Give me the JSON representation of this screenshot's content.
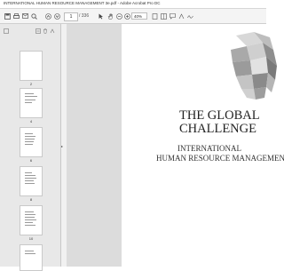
{
  "window": {
    "title": "INTERNATIONAL HUMAN RESOURCE MANAGEMENT 3e.pdf - Adobe Acrobat Pro DC"
  },
  "toolbar": {
    "page_value": "1",
    "page_total": "/ 336",
    "zoom_value": "40%"
  },
  "sidebar": {
    "thumbnails": [
      {
        "label": "2"
      },
      {
        "label": "4"
      },
      {
        "label": "6"
      },
      {
        "label": "8"
      },
      {
        "label": "10"
      },
      {
        "label": ""
      }
    ]
  },
  "page": {
    "title_line1": "THE GLOBAL",
    "title_line2": "CHALLENGE",
    "subtitle_line1": "INTERNATIONAL",
    "subtitle_line2": "HUMAN RESOURCE MANAGEMENT"
  }
}
